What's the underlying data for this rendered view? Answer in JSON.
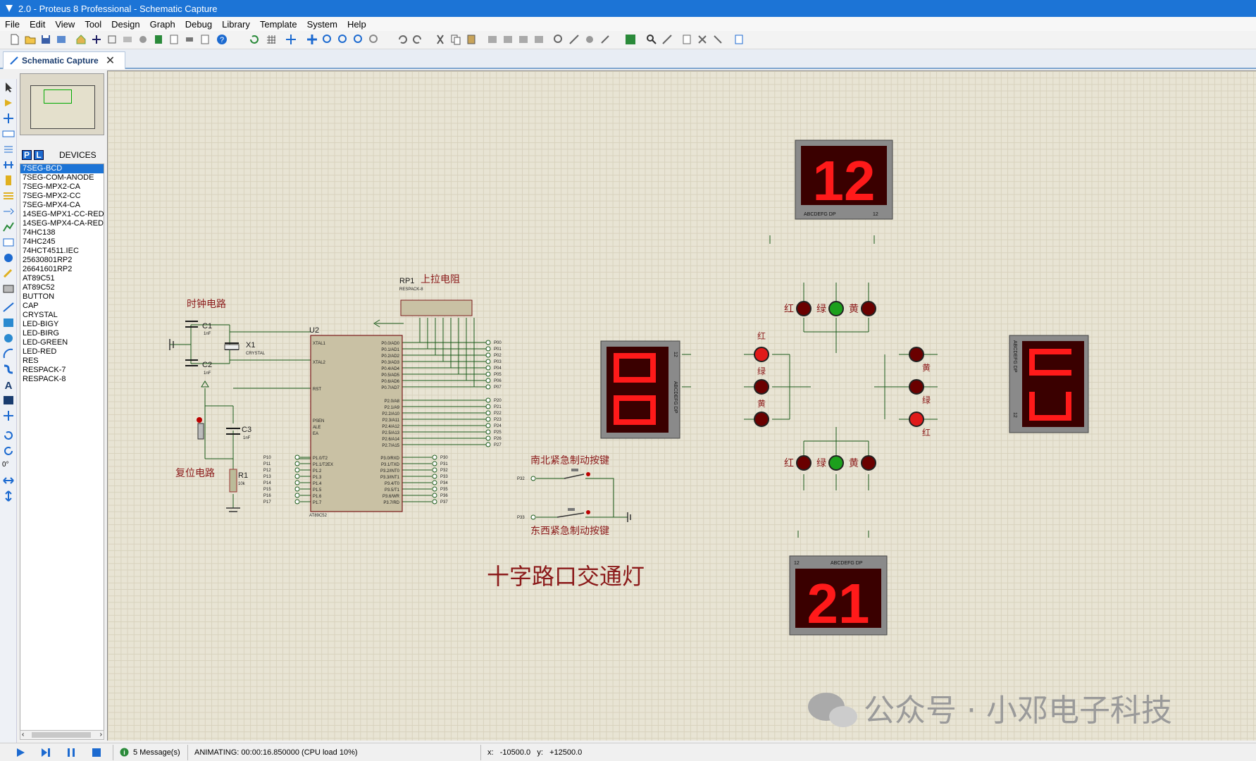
{
  "window": {
    "title": "2.0 - Proteus 8 Professional - Schematic Capture"
  },
  "menu": [
    "File",
    "Edit",
    "View",
    "Tool",
    "Design",
    "Graph",
    "Debug",
    "Library",
    "Template",
    "System",
    "Help"
  ],
  "tab": {
    "label": "Schematic Capture",
    "close": "✕"
  },
  "devices": {
    "header": "DEVICES",
    "p_label": "P",
    "l_label": "L",
    "items": [
      "7SEG-BCD",
      "7SEG-COM-ANODE",
      "7SEG-MPX2-CA",
      "7SEG-MPX2-CC",
      "7SEG-MPX4-CA",
      "14SEG-MPX1-CC-RED",
      "14SEG-MPX4-CA-RED",
      "74HC138",
      "74HC245",
      "74HCT4511.IEC",
      "25630801RP2",
      "26641601RP2",
      "AT89C51",
      "AT89C52",
      "BUTTON",
      "CAP",
      "CRYSTAL",
      "LED-BIGY",
      "LED-BIRG",
      "LED-GREEN",
      "LED-RED",
      "RES",
      "RESPACK-7",
      "RESPACK-8"
    ],
    "selected": "7SEG-BCD"
  },
  "rotation": "0°",
  "schematic": {
    "title": "十字路口交通灯",
    "labels": {
      "clock": "时钟电路",
      "reset": "复位电路",
      "pullup": "上拉电阻",
      "ns_button": "南北紧急制动按键",
      "ew_button": "东西紧急制动按键"
    },
    "components": {
      "C1": "C1",
      "C1v": "1nF",
      "C2": "C2",
      "C2v": "1nF",
      "C3": "C3",
      "C3v": "1nF",
      "X1": "X1",
      "X1v": "CRYSTAL",
      "R1": "R1",
      "R1v": "10k",
      "RP1": "RP1",
      "RP1v": "RESPACK-8",
      "U2": "U2",
      "U2v": "AT89C52"
    },
    "mcu_left_pins": [
      "XTAL1",
      "XTAL2",
      "RST",
      "PSEN",
      "ALE",
      "EA",
      "P1.0/T2",
      "P1.1/T2EX",
      "P1.2",
      "P1.3",
      "P1.4",
      "P1.5",
      "P1.6",
      "P1.7"
    ],
    "mcu_right_pins": [
      "P0.0/AD0",
      "P0.1/AD1",
      "P0.2/AD2",
      "P0.3/AD3",
      "P0.4/AD4",
      "P0.5/AD5",
      "P0.6/AD6",
      "P0.7/AD7",
      "P2.0/A8",
      "P2.1/A9",
      "P2.2/A10",
      "P2.3/A11",
      "P2.4/A12",
      "P2.5/A13",
      "P2.6/A14",
      "P2.7/A15",
      "P3.0/RXD",
      "P3.1/TXD",
      "P3.2/INT0",
      "P3.3/INT1",
      "P3.4/T0",
      "P3.5/T1",
      "P3.6/WR",
      "P3.7/RD"
    ],
    "p0_nets": [
      "P00",
      "P01",
      "P02",
      "P03",
      "P04",
      "P05",
      "P06",
      "P07"
    ],
    "p2_nets": [
      "P20",
      "P21",
      "P22",
      "P23",
      "P24",
      "P25",
      "P26",
      "P27"
    ],
    "p3_nets": [
      "P30",
      "P31",
      "P32",
      "P33",
      "P34",
      "P35",
      "P36",
      "P37"
    ],
    "p1_nets": [
      "P10",
      "P11",
      "P12",
      "P13",
      "P14",
      "P15",
      "P16",
      "P17"
    ],
    "displays": {
      "north": "12",
      "south": "21",
      "west": "",
      "east": ""
    },
    "seg_label": "ABCDEFG DP",
    "seg_digits": "12",
    "lights": {
      "red": "红",
      "green": "绿",
      "yellow": "黄"
    },
    "btn_nets": {
      "ns": "P32",
      "ew": "P33"
    }
  },
  "watermark": "公众号 · 小邓电子科技",
  "status": {
    "messages": "5 Message(s)",
    "animating": "ANIMATING: 00:00:16.850000 (CPU load 10%)",
    "x_label": "x:",
    "x_value": "-10500.0",
    "y_label": "y:",
    "y_value": "+12500.0"
  },
  "colors": {
    "accent": "#1c74d6",
    "wire": "#1a5a1a",
    "seg_on": "#ff1a1a",
    "seg_bg": "#3a0000",
    "label_red": "#8b1a1a"
  }
}
